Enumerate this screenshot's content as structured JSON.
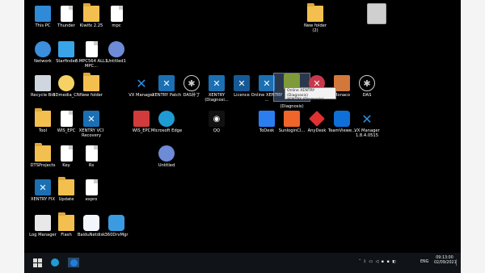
{
  "desktop": {
    "icons": [
      {
        "name": "this-pc-icon",
        "label": "This PC"
      },
      {
        "name": "thunder-icon",
        "label": "Thunder"
      },
      {
        "name": "folder-icon",
        "label": "Kiwifx 2.25"
      },
      {
        "name": "file-icon",
        "label": "mpc"
      },
      {
        "name": "folder-icon",
        "label": "New folder\n(2)"
      },
      {
        "name": "network-icon",
        "label": "Network"
      },
      {
        "name": "starfinder-icon",
        "label": "Starfinder"
      },
      {
        "name": "file-icon",
        "label": "3.MPC564 ALL1 MPC..."
      },
      {
        "name": "untitled-icon",
        "label": "Untitled1"
      },
      {
        "name": "recycle-bin-icon",
        "label": "Recycle Bin"
      },
      {
        "name": "dmedia-icon",
        "label": "3Dmedia_CN"
      },
      {
        "name": "folder-icon",
        "label": "New folder"
      },
      {
        "name": "vx-manager-icon",
        "label": "VX Manager"
      },
      {
        "name": "xentry-patch-icon",
        "label": "XENTRY Patch"
      },
      {
        "name": "das-icon",
        "label": "DAS补丁"
      },
      {
        "name": "xentry-diagnosis-icon",
        "label": "XENTRY (Diagnosi..."
      },
      {
        "name": "licence-icon",
        "label": "Licence"
      },
      {
        "name": "online-xentry-icon",
        "label": "Online XENTRY ..."
      },
      {
        "name": "xentry-diagnosis-selected-icon",
        "label": "(Diagnosis)"
      },
      {
        "name": "xentry-pass-icon",
        "label": ""
      },
      {
        "name": "monaco-icon",
        "label": "Monaco"
      },
      {
        "name": "das-icon",
        "label": "DAS"
      },
      {
        "name": "folder-icon",
        "label": "Tool"
      },
      {
        "name": "file-icon",
        "label": "WIS_EPC"
      },
      {
        "name": "xentry-vci-icon",
        "label": "XENTRY VCI Recovery"
      },
      {
        "name": "wis-epc-icon",
        "label": "WIS_EPC"
      },
      {
        "name": "edge-icon",
        "label": "Microsoft Edge"
      },
      {
        "name": "qq-icon",
        "label": "QQ"
      },
      {
        "name": "todesk-icon",
        "label": "ToDesk"
      },
      {
        "name": "sunlogin-icon",
        "label": "SunloginCl..."
      },
      {
        "name": "anydesk-icon",
        "label": "AnyDesk"
      },
      {
        "name": "teamviewer-icon",
        "label": "TeamViewe..."
      },
      {
        "name": "vx-manager-icon",
        "label": "VX Manager 1.8.4.0515"
      },
      {
        "name": "folder-icon",
        "label": "DTSProjects"
      },
      {
        "name": "file-icon",
        "label": "Key"
      },
      {
        "name": "file-icon",
        "label": "Rs"
      },
      {
        "name": "untitled-icon",
        "label": "Untitled"
      },
      {
        "name": "xentry-fix-icon",
        "label": "XENTRY FIX"
      },
      {
        "name": "folder-icon",
        "label": "Update"
      },
      {
        "name": "file-icon",
        "label": "expro"
      },
      {
        "name": "log-manager-icon",
        "label": "Log Manager"
      },
      {
        "name": "folder-icon",
        "label": "Flash"
      },
      {
        "name": "baidunetdisk-icon",
        "label": "BaiduNetdisk"
      },
      {
        "name": "360-icon",
        "label": "360DrvMgr"
      }
    ]
  },
  "tooltip": {
    "line1": "Online XENTRY (Diagnosis)",
    "line2": "XENTRY (Diagnosis)"
  },
  "taskbar": {
    "tray_lang": "ENG",
    "time": "09:13:00",
    "date": "02/09/2021"
  },
  "colors": {
    "accent": "#1a73c8",
    "folder": "#f3c04f",
    "taskbar": "#101418"
  }
}
